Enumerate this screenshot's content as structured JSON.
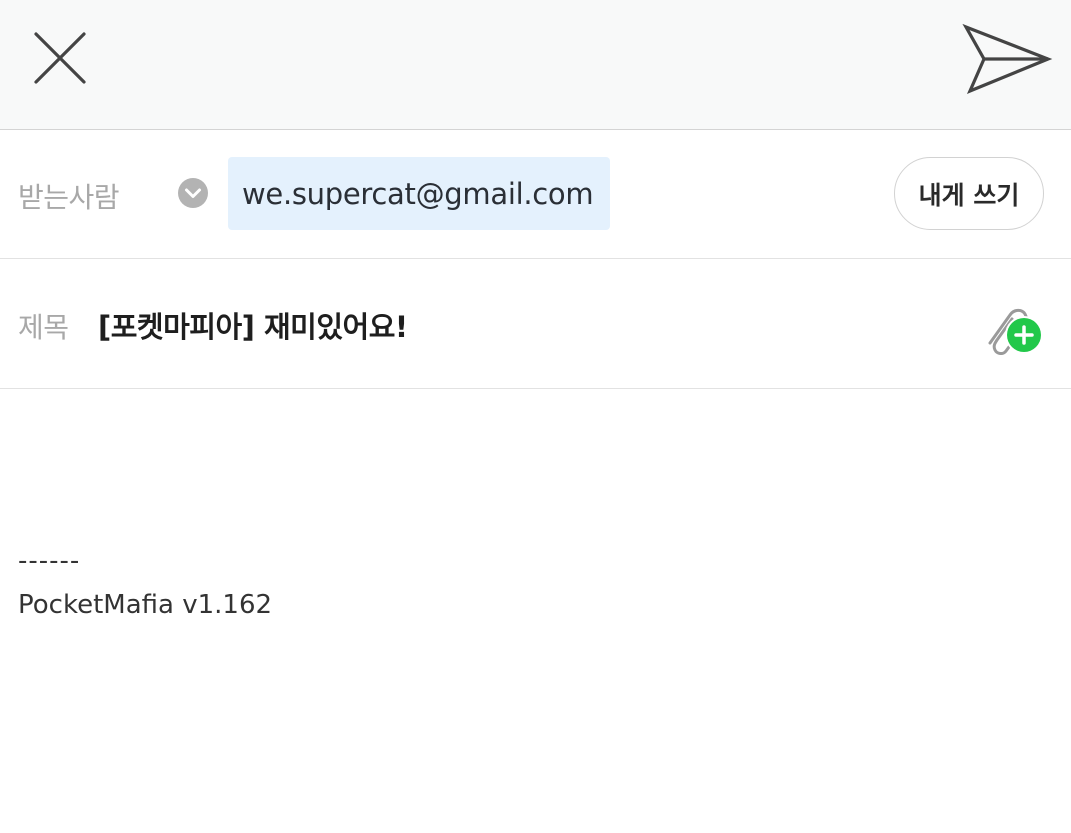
{
  "toolbar": {
    "close_icon": "close-icon",
    "send_icon": "send-icon"
  },
  "recipients": {
    "label": "받는사람",
    "expand_icon": "chevron-down-icon",
    "chip_text": "we.supercat@gmail.com",
    "self_button_label": "내게 쓰기"
  },
  "subject": {
    "label": "제목",
    "value": "[포켓마피아] 재미있어요!",
    "attach_icon": "paperclip-add-icon",
    "accent_color": "#22c84a"
  },
  "body": {
    "signature_divider": "------",
    "signature_text": "PocketMafia v1.162"
  }
}
